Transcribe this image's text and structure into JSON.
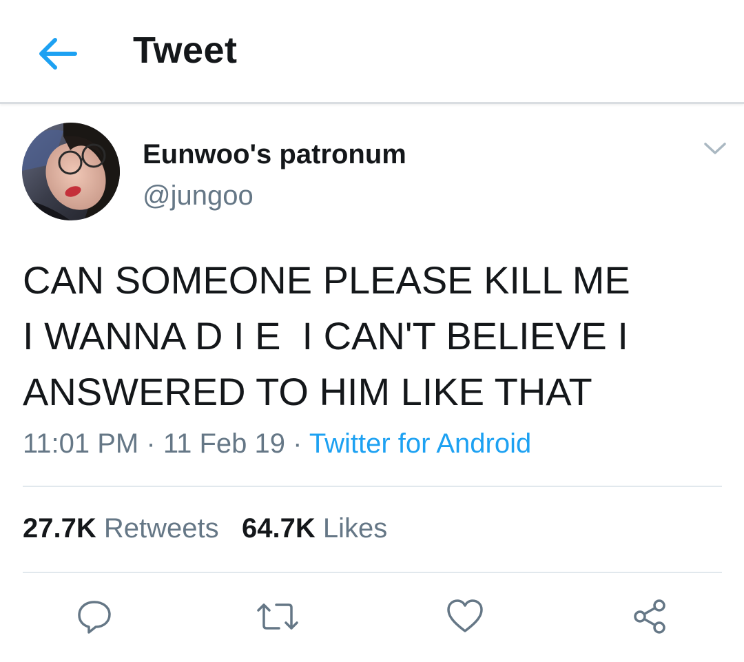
{
  "header": {
    "back_icon": "arrow-left-icon",
    "title": "Tweet",
    "accent_color": "#1da1f2"
  },
  "tweet": {
    "user": {
      "display_name": "Eunwoo's patronum",
      "handle": "@jungoo"
    },
    "text_lines": [
      "CAN SOMEONE PLEASE KILL ME",
      "I WANNA D I E  I CAN'T BELIEVE I",
      "ANSWERED TO HIM LIKE THAT"
    ],
    "time": "11:01 PM",
    "date": "11 Feb 19",
    "separator": "·",
    "source": "Twitter for Android",
    "stats": {
      "retweets_count": "27.7K",
      "retweets_label": "Retweets",
      "likes_count": "64.7K",
      "likes_label": "Likes"
    },
    "actions": [
      {
        "icon": "reply-icon"
      },
      {
        "icon": "retweet-icon"
      },
      {
        "icon": "like-heart-icon"
      },
      {
        "icon": "share-icon"
      }
    ]
  },
  "colors": {
    "text_primary": "#14171a",
    "text_secondary": "#657786",
    "link": "#1da1f2",
    "divider": "#e1e8ed"
  }
}
